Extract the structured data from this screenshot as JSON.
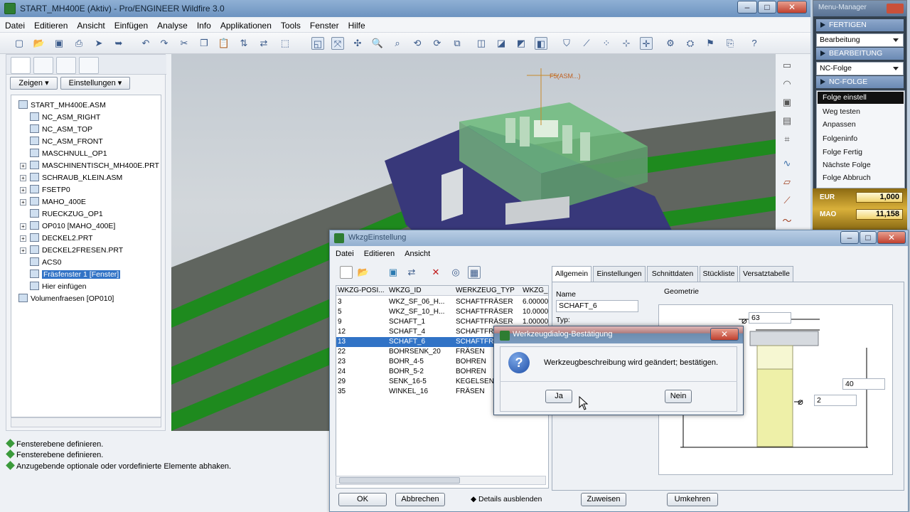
{
  "main": {
    "title": "START_MH400E (Aktiv) - Pro/ENGINEER Wildfire 3.0",
    "menu": [
      "Datei",
      "Editieren",
      "Ansicht",
      "Einfügen",
      "Analyse",
      "Info",
      "Applikationen",
      "Tools",
      "Fenster",
      "Hilfe"
    ]
  },
  "left": {
    "show_label": "Zeigen",
    "settings_label": "Einstellungen",
    "tree": [
      {
        "label": "START_MH400E.ASM",
        "indent": 0,
        "plus": false
      },
      {
        "label": "NC_ASM_RIGHT",
        "indent": 1,
        "plus": false
      },
      {
        "label": "NC_ASM_TOP",
        "indent": 1,
        "plus": false
      },
      {
        "label": "NC_ASM_FRONT",
        "indent": 1,
        "plus": false
      },
      {
        "label": "MASCHNULL_OP1",
        "indent": 1,
        "plus": false
      },
      {
        "label": "MASCHINENTISCH_MH400E.PRT",
        "indent": 1,
        "plus": true
      },
      {
        "label": "SCHRAUB_KLEIN.ASM",
        "indent": 1,
        "plus": true
      },
      {
        "label": "FSETP0",
        "indent": 1,
        "plus": true
      },
      {
        "label": "MAHO_400E",
        "indent": 1,
        "plus": true
      },
      {
        "label": "RUECKZUG_OP1",
        "indent": 1,
        "plus": false
      },
      {
        "label": "OP010 [MAHO_400E]",
        "indent": 1,
        "plus": true
      },
      {
        "label": "DECKEL2.PRT",
        "indent": 1,
        "plus": true
      },
      {
        "label": "DECKEL2FRESEN.PRT",
        "indent": 1,
        "plus": true
      },
      {
        "label": "ACS0",
        "indent": 1,
        "plus": false
      },
      {
        "label": "Fräsfenster 1 [Fenster]",
        "indent": 1,
        "plus": false,
        "selected": true
      },
      {
        "label": "Hier einfügen",
        "indent": 1,
        "plus": false
      },
      {
        "label": "Volumenfraesen [OP010]",
        "indent": 0,
        "plus": false
      }
    ]
  },
  "messages": [
    "Fensterebene definieren.",
    "Fensterebene definieren.",
    "Anzugebende optionale oder vordefinierte Elemente abhaken."
  ],
  "viewport": {
    "label": "F5(ASM...)"
  },
  "menu_manager": {
    "title": "Menu-Manager",
    "fertigen": "FERTIGEN",
    "bearbeitung_select": "Bearbeitung",
    "bearbeitung": "BEARBEITUNG",
    "ncfolge_select": "NC-Folge",
    "ncfolge": "NC-FOLGE",
    "items": [
      "Folge einstell",
      "Weg testen",
      "Anpassen",
      "Folgeninfo",
      "Folge Fertig",
      "Nächste Folge",
      "Folge Abbruch"
    ]
  },
  "gold": {
    "eur_label": "EUR",
    "eur_value": "1,000",
    "mao_label": "MAO",
    "mao_value": "11,158"
  },
  "wkzg": {
    "title": "WkzgEinstellung",
    "menu": [
      "Datei",
      "Editieren",
      "Ansicht"
    ],
    "headers": [
      "WKZG-POSI...",
      "WKZG_ID",
      "WERKZEUG_TYP",
      "WKZG_..."
    ],
    "rows": [
      [
        "3",
        "WKZ_SF_06_H...",
        "SCHAFTFRÄSER",
        "6.00000"
      ],
      [
        "5",
        "WKZ_SF_10_H...",
        "SCHAFTFRÄSER",
        "10.0000"
      ],
      [
        "9",
        "SCHAFT_1",
        "SCHAFTFRÄSER",
        "1.00000"
      ],
      [
        "12",
        "SCHAFT_4",
        "SCHAFTFRÄ...",
        ""
      ],
      [
        "13",
        "SCHAFT_6",
        "SCHAFTFR...",
        ""
      ],
      [
        "22",
        "BOHRSENK_20",
        "FRÄSEN",
        ""
      ],
      [
        "23",
        "BOHR_4-5",
        "BOHREN",
        ""
      ],
      [
        "24",
        "BOHR_5-2",
        "BOHREN",
        ""
      ],
      [
        "29",
        "SENK_16-5",
        "KEGELSEN...",
        ""
      ],
      [
        "35",
        "WINKEL_16",
        "FRÄSEN",
        ""
      ]
    ],
    "ok": "OK",
    "cancel": "Abbrechen",
    "details": "Details ausblenden",
    "tabs": [
      "Allgemein",
      "Einstellungen",
      "Schnittdaten",
      "Stückliste",
      "Versatztabelle"
    ],
    "name_label": "Name",
    "name_value": "SCHAFT_6",
    "type_label": "Typ:",
    "geometry_label": "Geometrie",
    "dim_diameter": "63",
    "dim_length": "40",
    "dim_small": "2",
    "assign": "Zuweisen",
    "revert": "Umkehren"
  },
  "confirm": {
    "title": "Werkzeugdialog-Bestätigung",
    "message": "Werkzeugbeschreibung wird geändert; bestätigen.",
    "yes": "Ja",
    "no": "Nein"
  }
}
